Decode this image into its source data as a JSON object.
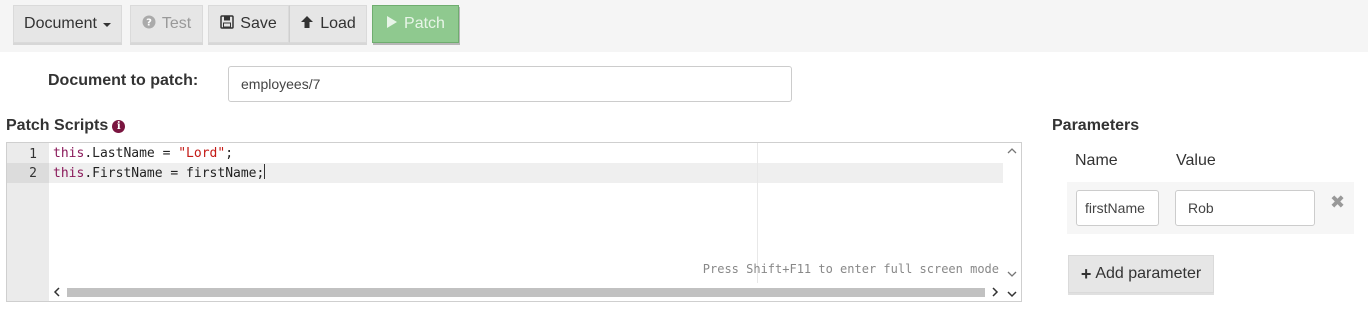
{
  "toolbar": {
    "document_label": "Document",
    "test_label": "Test",
    "save_label": "Save",
    "load_label": "Load",
    "patch_label": "Patch"
  },
  "document": {
    "label": "Document to patch:",
    "value": "employees/7"
  },
  "scripts": {
    "title": "Patch Scripts",
    "lines": [
      {
        "number": "1",
        "kw": "this",
        "rest": ".LastName = ",
        "str": "\"Lord\"",
        "end": ";"
      },
      {
        "number": "2",
        "kw": "this",
        "rest": ".FirstName = firstName;",
        "str": "",
        "end": ""
      }
    ],
    "fullscreen_hint": "Press Shift+F11 to enter full screen mode"
  },
  "parameters": {
    "title": "Parameters",
    "name_header": "Name",
    "value_header": "Value",
    "rows": [
      {
        "name": "firstName",
        "value": "Rob"
      }
    ],
    "add_label": "Add parameter"
  }
}
